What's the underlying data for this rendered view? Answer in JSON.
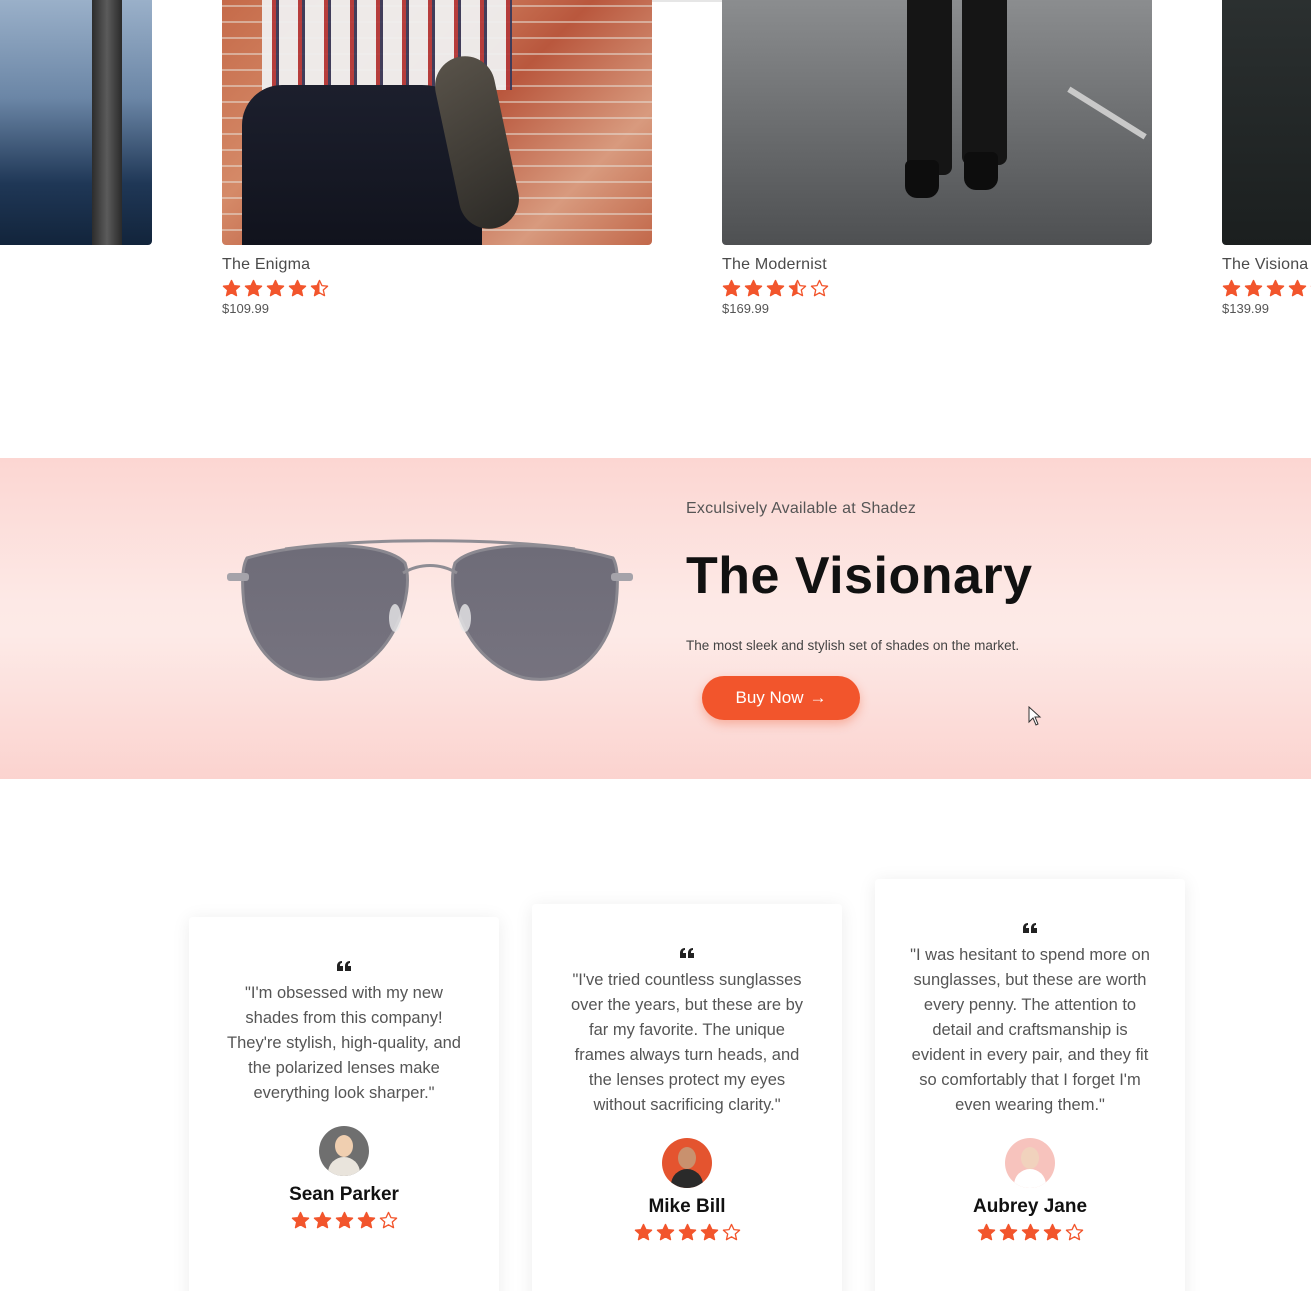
{
  "products": [
    {
      "name": "",
      "price": "",
      "rating": null
    },
    {
      "name": "The Enigma",
      "price": "$109.99",
      "rating": 4.5
    },
    {
      "name": "The Modernist",
      "price": "$169.99",
      "rating": 3.5
    },
    {
      "name": "The Visiona",
      "price": "$139.99",
      "rating": 4
    }
  ],
  "hero": {
    "eyebrow": "Exculsively Available at Shadez",
    "title": "The Visionary",
    "description": "The most sleek and stylish set of shades on the market.",
    "cta_label": "Buy Now",
    "cta_arrow": "→"
  },
  "testimonials": [
    {
      "quote": "\"I'm obsessed with my new shades from this company! They're stylish, high-quality, and the polarized lenses make everything look sharper.\"",
      "name": "Sean Parker",
      "rating": 4
    },
    {
      "quote": "\"I've tried countless sunglasses over the years, but these are by far my favorite. The unique frames always turn heads, and the lenses protect my eyes without sacrificing clarity.\"",
      "name": "Mike Bill",
      "rating": 4
    },
    {
      "quote": "\"I was hesitant to spend more on sunglasses, but these are worth every penny. The attention to detail and craftsmanship is evident in every pair, and they fit so comfortably that I forget I'm even wearing them.\"",
      "name": "Aubrey Jane",
      "rating": 4
    }
  ],
  "colors": {
    "accent": "#f2552c",
    "star": "#f2552c",
    "carousel_active": "#2f6fd6"
  },
  "icons": {
    "star": "star-icon",
    "quote": "quote-icon",
    "cursor": "cursor-icon"
  }
}
